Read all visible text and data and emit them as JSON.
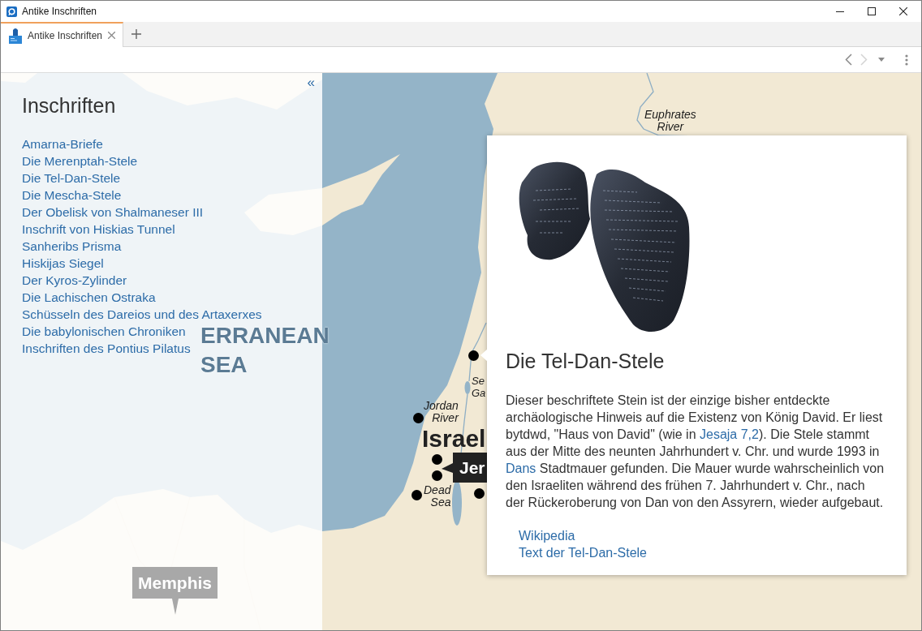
{
  "window": {
    "title": "Antike Inschriften"
  },
  "tabs": [
    {
      "label": "Antike Inschriften",
      "selected": true
    }
  ],
  "navigation": [
    {
      "kind": "back",
      "disabled": false
    },
    {
      "kind": "forward",
      "disabled": true
    }
  ],
  "sidebar": {
    "collapse": "«",
    "title": "Inschriften",
    "items": [
      "Amarna-Briefe",
      "Die Merenptah-Stele",
      "Die Tel-Dan-Stele",
      "Die Mescha-Stele",
      "Der Obelisk von Shalmaneser III",
      "Inschrift von Hiskias Tunnel",
      "Sanheribs Prisma",
      "Hiskijas Siegel",
      "Der Kyros-Zylinder",
      "Die Lachischen Ostraka",
      "Schüsseln des Dareios und des Artaxerxes",
      "Die babylonischen Chroniken",
      "Inschriften des Pontius Pilatus"
    ]
  },
  "map": {
    "labels": [
      {
        "kind": "water",
        "text": "Euphrates River"
      },
      {
        "kind": "sea",
        "text": "ERRANEAN SEA"
      },
      {
        "kind": "water",
        "text": "Se Ga"
      },
      {
        "kind": "water",
        "text": "Jordan River"
      },
      {
        "kind": "country",
        "text": "Israel"
      },
      {
        "kind": "city",
        "text": "Jer"
      },
      {
        "kind": "water",
        "text": "Dead Sea"
      },
      {
        "kind": "city-muted",
        "text": "Memphis"
      }
    ]
  },
  "popup": {
    "title": "Die Tel-Dan-Stele",
    "description": [
      {
        "kind": "text",
        "text": "Dieser beschriftete Stein ist der einzige bisher entdeckte archäologische Hinweis auf die Existenz von König David. Er liest bytdwd, \"Haus von David\" (wie in "
      },
      {
        "kind": "link",
        "text": "Jesaja 7,2"
      },
      {
        "kind": "text",
        "text": "). Die Stele stammt aus der Mitte des neunten Jahrhundert v. Chr. und wurde 1993 in "
      },
      {
        "kind": "link",
        "text": "Dans"
      },
      {
        "kind": "text",
        "text": " Stadtmauer gefunden. Die Mauer wurde wahrscheinlich von den Israeliten während des frühen 7. Jahrhundert v. Chr., nach der Rückeroberung von Dan von den Assyrern, wieder aufgebaut."
      }
    ],
    "links": [
      "Wikipedia",
      "Text der Tel-Dan-Stele"
    ]
  }
}
